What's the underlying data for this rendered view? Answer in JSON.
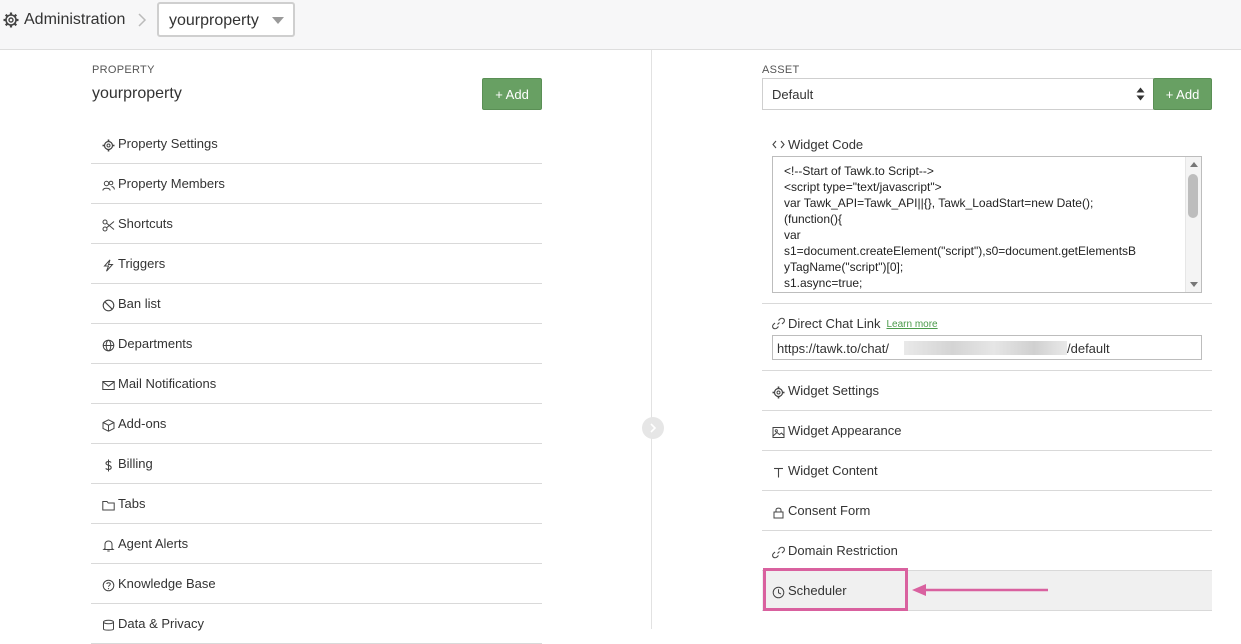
{
  "header": {
    "breadcrumb_title": "Administration",
    "property_select_value": "yourproperty"
  },
  "property_panel": {
    "section_label": "PROPERTY",
    "property_name": "yourproperty",
    "add_label": "+ Add",
    "menu": [
      {
        "label": "Property Settings",
        "icon": "gear-icon"
      },
      {
        "label": "Property Members",
        "icon": "users-icon"
      },
      {
        "label": "Shortcuts",
        "icon": "scissors-icon"
      },
      {
        "label": "Triggers",
        "icon": "lightning-icon"
      },
      {
        "label": "Ban list",
        "icon": "ban-icon"
      },
      {
        "label": "Departments",
        "icon": "globe-icon"
      },
      {
        "label": "Mail Notifications",
        "icon": "envelope-icon"
      },
      {
        "label": "Add-ons",
        "icon": "box-icon"
      },
      {
        "label": "Billing",
        "icon": "dollar-icon"
      },
      {
        "label": "Tabs",
        "icon": "folder-icon"
      },
      {
        "label": "Agent Alerts",
        "icon": "bell-icon"
      },
      {
        "label": "Knowledge Base",
        "icon": "question-icon"
      },
      {
        "label": "Data & Privacy",
        "icon": "database-icon"
      }
    ]
  },
  "asset_panel": {
    "section_label": "ASSET",
    "asset_select_value": "Default",
    "add_label": "+ Add",
    "widget_code": {
      "title": "Widget Code",
      "lines": [
        "<!--Start of Tawk.to Script-->",
        "<script type=\"text/javascript\">",
        "var Tawk_API=Tawk_API||{}, Tawk_LoadStart=new Date();",
        "(function(){",
        "var",
        "s1=document.createElement(\"script\"),s0=document.getElementsB",
        "yTagName(\"script\")[0];",
        "s1.async=true;"
      ]
    },
    "direct_chat_link": {
      "title": "Direct Chat Link",
      "learn_more": "Learn more",
      "url_prefix": "https://tawk.to/chat/",
      "url_suffix": "/default"
    },
    "menu": [
      {
        "label": "Widget Settings",
        "icon": "gear-icon"
      },
      {
        "label": "Widget Appearance",
        "icon": "image-icon"
      },
      {
        "label": "Widget Content",
        "icon": "text-icon"
      },
      {
        "label": "Consent Form",
        "icon": "lock-icon"
      },
      {
        "label": "Domain Restriction",
        "icon": "link-icon"
      },
      {
        "label": "Scheduler",
        "icon": "clock-icon",
        "active": true
      }
    ]
  },
  "colors": {
    "add_button": "#68a063",
    "annotation": "#d9619f",
    "learn_more_link": "#4a9a4a"
  }
}
